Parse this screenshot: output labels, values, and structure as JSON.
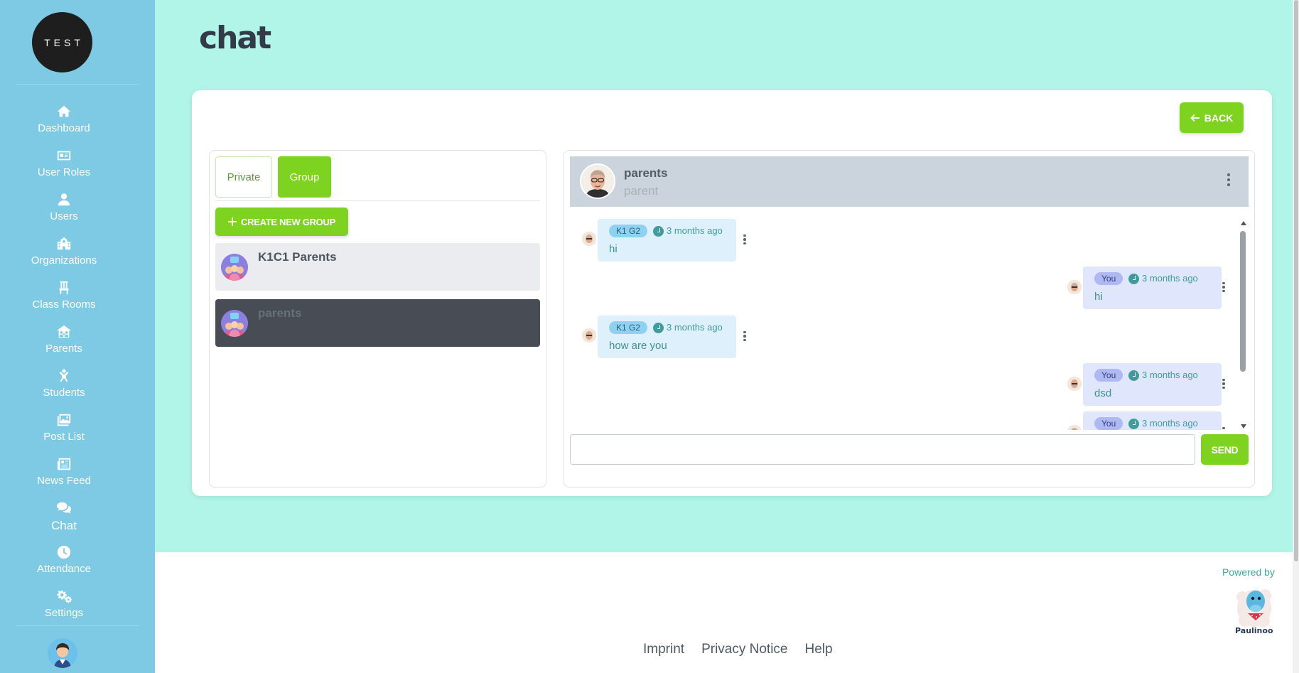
{
  "brand": {
    "logo_text": "TEST"
  },
  "sidebar": {
    "items": [
      {
        "label": "Dashboard",
        "icon": "home-icon"
      },
      {
        "label": "User Roles",
        "icon": "id-card-icon"
      },
      {
        "label": "Users",
        "icon": "user-icon"
      },
      {
        "label": "Organizations",
        "icon": "school-icon"
      },
      {
        "label": "Class Rooms",
        "icon": "chair-icon"
      },
      {
        "label": "Parents",
        "icon": "family-icon"
      },
      {
        "label": "Students",
        "icon": "child-icon"
      },
      {
        "label": "Post List",
        "icon": "images-icon"
      },
      {
        "label": "News Feed",
        "icon": "newspaper-icon"
      },
      {
        "label": "Chat",
        "icon": "comments-icon"
      },
      {
        "label": "Attendance",
        "icon": "clock-icon"
      },
      {
        "label": "Settings",
        "icon": "gears-icon"
      }
    ],
    "active": "Chat"
  },
  "page": {
    "title": "chat"
  },
  "toolbar": {
    "back_label": "BACK"
  },
  "tabs": {
    "private": "Private",
    "group": "Group",
    "active": "Group"
  },
  "groups_panel": {
    "create_label": "CREATE NEW GROUP",
    "groups": [
      {
        "name": "K1C1 Parents",
        "selected": false
      },
      {
        "name": "parents",
        "selected": true
      }
    ]
  },
  "conversation": {
    "name": "parents",
    "subtitle": "parent",
    "messages": [
      {
        "sender": "K1 G2",
        "time": "3 months ago",
        "text": "hi",
        "direction": "in"
      },
      {
        "sender": "You",
        "time": "3 months ago",
        "text": "hi",
        "direction": "out"
      },
      {
        "sender": "K1 G2",
        "time": "3 months ago",
        "text": "how are you",
        "direction": "in"
      },
      {
        "sender": "You",
        "time": "3 months ago",
        "text": "dsd",
        "direction": "out"
      },
      {
        "sender": "You",
        "time": "3 months ago",
        "text": "",
        "direction": "out"
      }
    ]
  },
  "composer": {
    "placeholder": "",
    "send_label": "SEND"
  },
  "footer": {
    "links": [
      "Imprint",
      "Privacy Notice",
      "Help"
    ],
    "powered_by": "Powered by",
    "brand": "Paulinoo"
  },
  "colors": {
    "accent": "#7ed321",
    "sidebar": "#7ec9e3",
    "background": "#b0f5e7"
  }
}
